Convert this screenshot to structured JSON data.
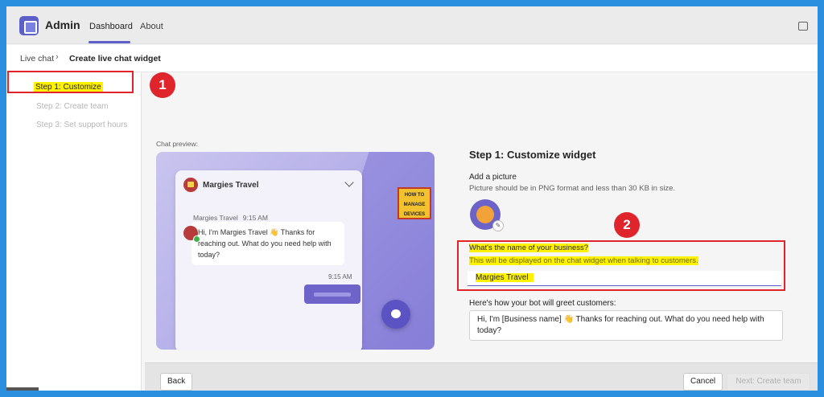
{
  "app": {
    "name": "Admin",
    "tabs": [
      "Dashboard",
      "About"
    ],
    "active_tab": "Dashboard"
  },
  "breadcrumb": {
    "parent": "Live chat",
    "current": "Create live chat widget"
  },
  "steps": [
    "Step 1: Customize",
    "Step 2: Create team",
    "Step 3: Set support hours"
  ],
  "annotations": {
    "badge1": "1",
    "badge2": "2",
    "highlight_color": "#fff200",
    "box_color": "#e0242b"
  },
  "preview": {
    "label": "Chat preview:",
    "business_name": "Margies Travel",
    "meta_name": "Margies Travel",
    "meta_time": "9:15 AM",
    "message": "Hi, I'm Margies Travel 👋 Thanks for reaching out. What do you need help with today?",
    "out_time": "9:15 AM",
    "logo_text": "HOW TO MANAGE DEVICES"
  },
  "form": {
    "title": "Step 1: Customize widget",
    "add_picture": "Add a picture",
    "picture_hint": "Picture should be in PNG format and less than 30 KB in size.",
    "business_question": "What's the name of your business?",
    "business_hint": "This will be displayed on the chat widget when talking to customers.",
    "business_value": "Margies Travel",
    "greet_label": "Here's how your bot will greet customers:",
    "greet_text": "Hi, I'm [Business name] 👋 Thanks for reaching out. What do you need help with today?"
  },
  "footer": {
    "back": "Back",
    "cancel": "Cancel",
    "next": "Next: Create team"
  },
  "colors": {
    "accent": "#5b5fc7",
    "border_blue": "#2b8fe0"
  }
}
